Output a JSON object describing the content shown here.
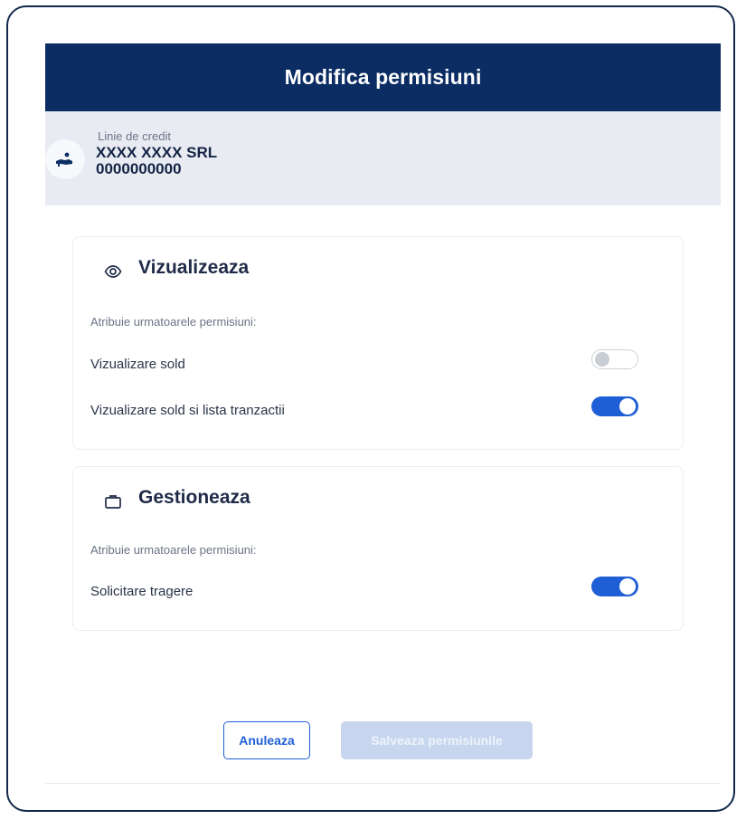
{
  "modal": {
    "title": "Modifica permisiuni"
  },
  "account": {
    "type": "Linie de credit",
    "name": "XXXX XXXX SRL",
    "number": "0000000000",
    "icon": "hand-money-icon"
  },
  "sections": [
    {
      "title": "Vizualizeaza",
      "icon": "eye-icon",
      "hint": "Atribuie urmatoarele permisiuni:",
      "permissions": [
        {
          "label": "Vizualizare sold",
          "enabled": false
        },
        {
          "label": "Vizualizare sold si lista tranzactii",
          "enabled": true
        }
      ]
    },
    {
      "title": "Gestioneaza",
      "icon": "briefcase-icon",
      "hint": "Atribuie urmatoarele permisiuni:",
      "permissions": [
        {
          "label": "Solicitare tragere",
          "enabled": true
        }
      ]
    }
  ],
  "footer": {
    "cancel_label": "Anuleaza",
    "save_label": "Salveaza permisiunile"
  },
  "colors": {
    "header": "#0b2d63",
    "accent": "#1f5fd6",
    "disabled_button": "#c7d6ee"
  }
}
